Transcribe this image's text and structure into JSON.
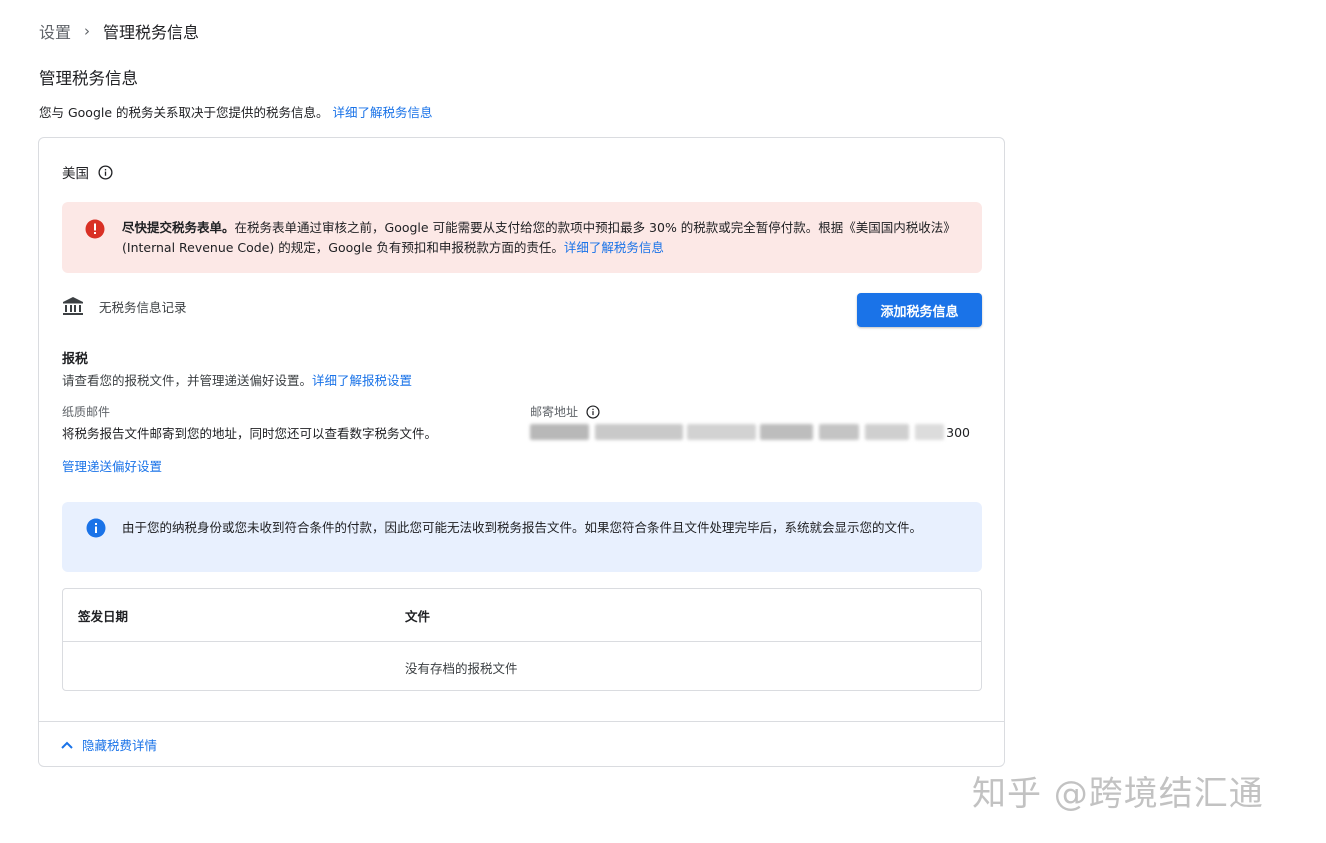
{
  "breadcrumb": {
    "root": "设置",
    "separator": "›",
    "current": "管理税务信息"
  },
  "page": {
    "title": "管理税务信息",
    "description": "您与 Google 的税务关系取决于您提供的税务信息。",
    "description_link": "详细了解税务信息"
  },
  "card": {
    "country": "美国",
    "error_alert": {
      "bold": "尽快提交税务表单。",
      "text": "在税务表单通过审核之前，Google 可能需要从支付给您的款项中预扣最多 30% 的税款或完全暂停付款。根据《美国国内税收法》(Internal Revenue Code) 的规定，Google 负有预扣和申报税款方面的责任。",
      "link": "详细了解税务信息"
    },
    "no_record_text": "无税务信息记录",
    "add_button_label": "添加税务信息",
    "tax_section": {
      "title": "报税",
      "description": "请查看您的报税文件，并管理递送偏好设置。",
      "link": "详细了解报税设置"
    },
    "paper_mail": {
      "label": "纸质邮件",
      "description": "将税务报告文件邮寄到您的地址，同时您还可以查看数字税务文件。"
    },
    "mailing_address": {
      "label": "邮寄地址",
      "visible_tail": "300"
    },
    "manage_link": "管理递送偏好设置",
    "info_alert": {
      "text": "由于您的纳税身份或您未收到符合条件的付款，因此您可能无法收到税务报告文件。如果您符合条件且文件处理完毕后，系统就会显示您的文件。"
    },
    "table": {
      "col_date": "签发日期",
      "col_file": "文件",
      "empty_text": "没有存档的报税文件"
    },
    "footer_toggle": "隐藏税费详情"
  },
  "watermark": "知乎 @跨境结汇通",
  "colors": {
    "accent": "#1a73e8",
    "error": "#d93025",
    "error_bg": "#fce8e6",
    "info_bg": "#e8f0fe"
  },
  "icons": [
    "chevron-right-icon",
    "info-outline-icon",
    "error-icon",
    "bank-icon",
    "info-icon",
    "chevron-up-icon"
  ]
}
